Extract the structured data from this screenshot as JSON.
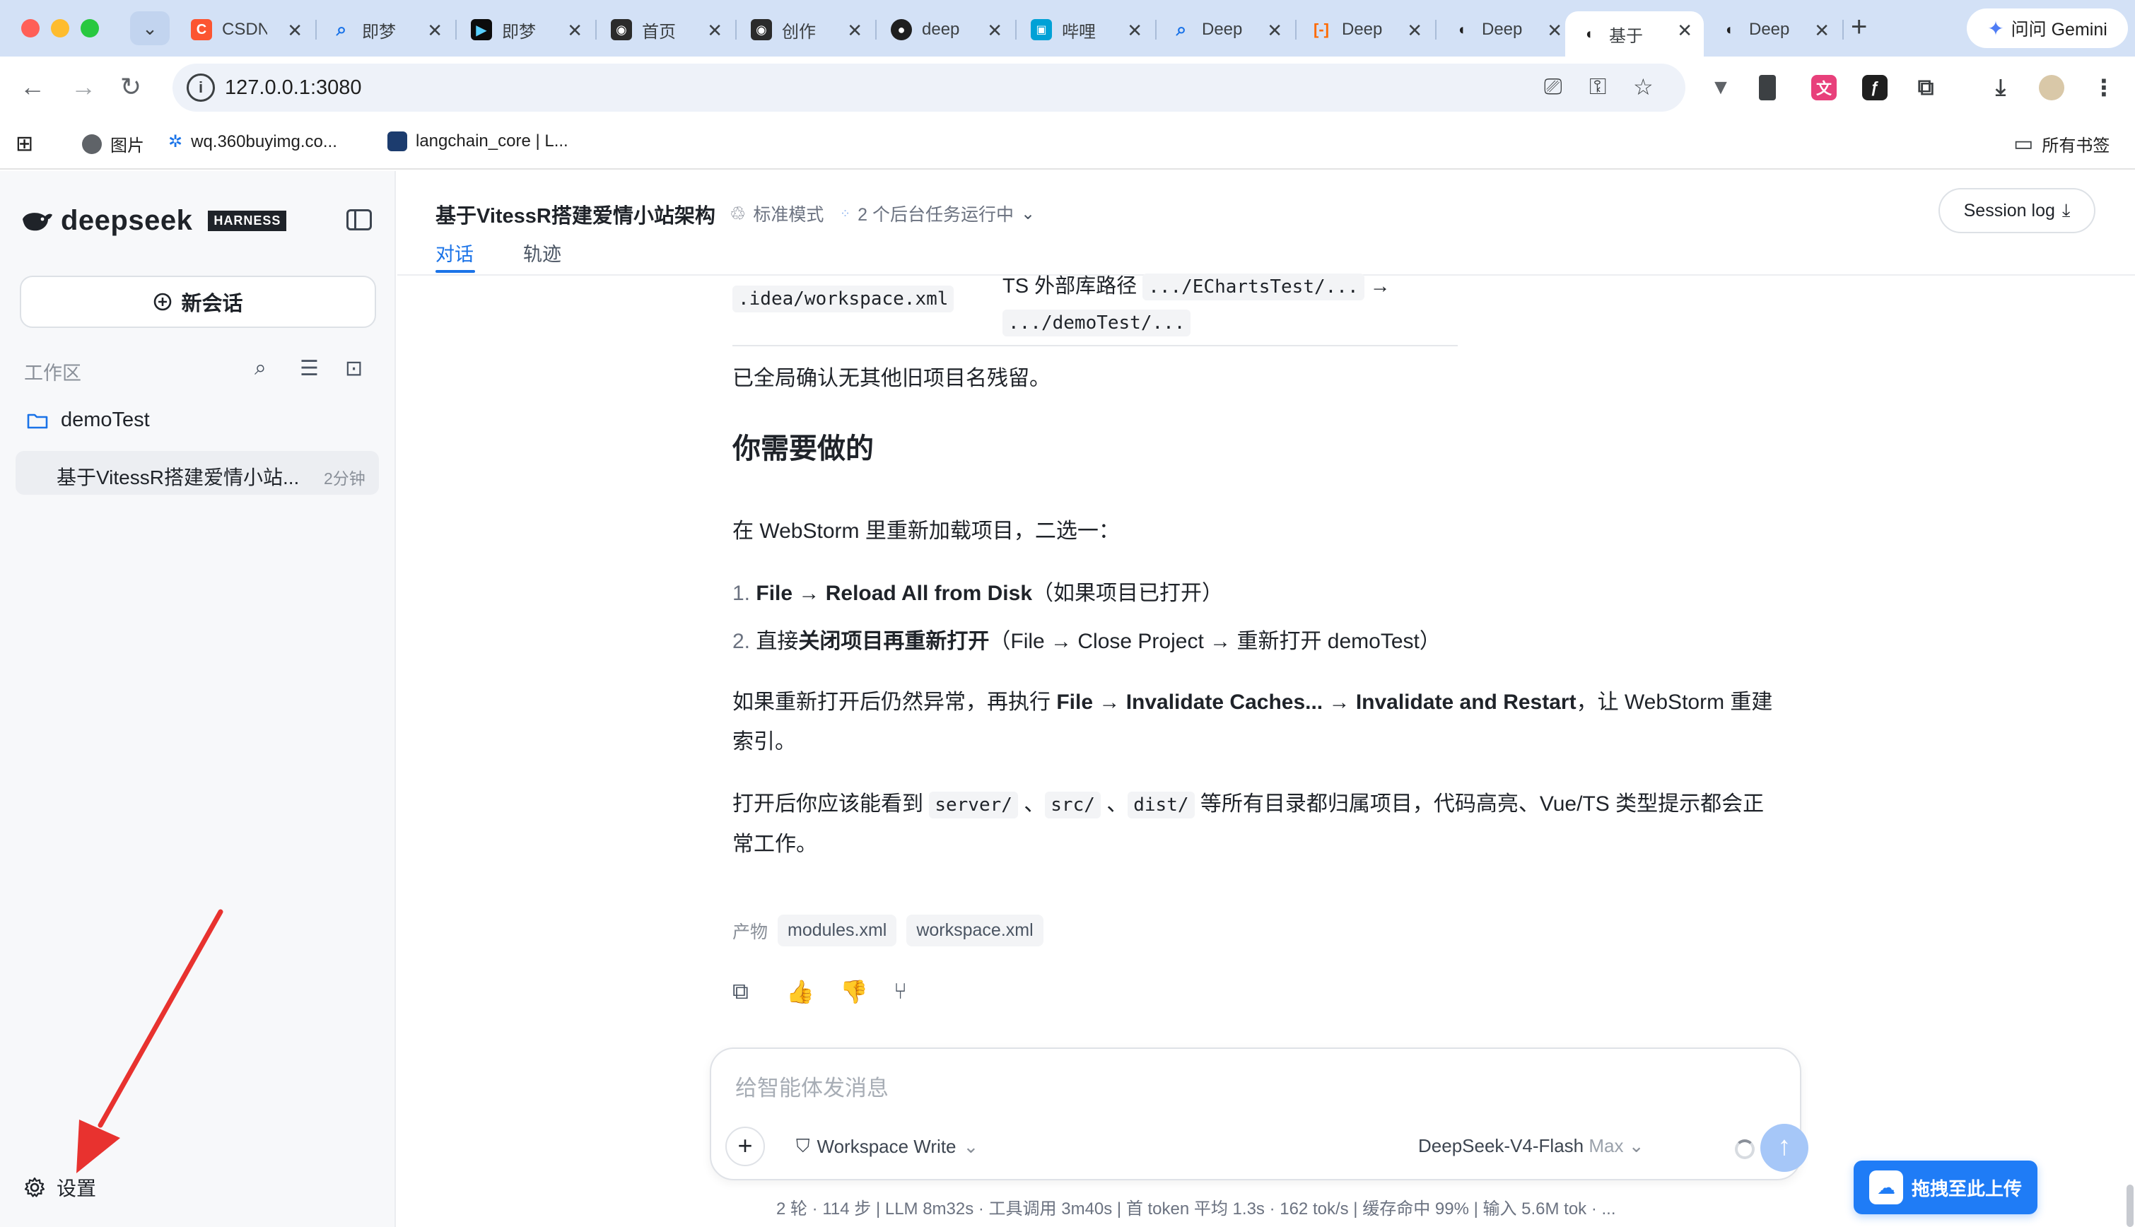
{
  "browser": {
    "tabs": [
      {
        "title": "CSDN",
        "icon": "csdn-icon",
        "color": "#fc5531"
      },
      {
        "title": "即梦",
        "icon": "search-icon",
        "color": "#1a73e8"
      },
      {
        "title": "即梦",
        "icon": "jimeng-icon",
        "color": "#0c0c0c"
      },
      {
        "title": "首页",
        "icon": "robot-icon",
        "color": "#2b2b2b"
      },
      {
        "title": "创作",
        "icon": "robot-icon",
        "color": "#2b2b2b"
      },
      {
        "title": "deep",
        "icon": "github-icon",
        "color": "#1f1f1f"
      },
      {
        "title": "哔哩",
        "icon": "bilibili-icon",
        "color": "#00a1d6"
      },
      {
        "title": "Deep",
        "icon": "search-icon",
        "color": "#1a73e8"
      },
      {
        "title": "Deep",
        "icon": "bracket-icon",
        "color": "#ff6a00"
      },
      {
        "title": "Deep",
        "icon": "whale-icon",
        "color": "#1f1f1f"
      },
      {
        "title": "基于",
        "icon": "whale-icon",
        "color": "#1f1f1f",
        "active": true
      },
      {
        "title": "Deep",
        "icon": "whale-icon",
        "color": "#1f1f1f"
      }
    ],
    "gemini_label": "问问 Gemini",
    "url": "127.0.0.1:3080",
    "bookmarks": [
      {
        "label": "图片"
      },
      {
        "label": "wq.360buyimg.co..."
      },
      {
        "label": "langchain_core | L..."
      }
    ],
    "all_bookmarks": "所有书签"
  },
  "sidebar": {
    "brand": "deepseek",
    "badge": "HARNESS",
    "new_chat": "新会话",
    "workspace_label": "工作区",
    "project": "demoTest",
    "session_title": "基于VitessR搭建爱情小站...",
    "session_time": "2分钟",
    "settings": "设置"
  },
  "header": {
    "title": "基于VitessR搭建爱情小站架构",
    "mode": "标准模式",
    "tasks": "2 个后台任务运行中",
    "tab_chat": "对话",
    "tab_trace": "轨迹",
    "session_log": "Session log"
  },
  "content": {
    "prev_file": ".idea/workspace.xml",
    "prev_desc": "TS 外部库路径",
    "prev_from": ".../EChartsTest/...",
    "prev_to": ".../demoTest/...",
    "confirm": "已全局确认无其他旧项目名残留。",
    "heading": "你需要做的",
    "intro": "在 WebStorm 里重新加载项目，二选一：",
    "item1_num": "1.",
    "item1_bold": "File → Reload All from Disk",
    "item1_rest": "（如果项目已打开）",
    "item2_num": "2.",
    "item2_pre": "直接",
    "item2_bold": "关闭项目再重新打开",
    "item2_rest": "（File → Close Project → 重新打开 demoTest）",
    "para1_pre": "如果重新打开后仍然异常，再执行 ",
    "para1_bold": "File → Invalidate Caches... → Invalidate and Restart",
    "para1_rest": "，让 WebStorm 重建索引。",
    "para2_pre": "打开后你应该能看到 ",
    "code1": "server/",
    "code2": "src/",
    "code3": "dist/",
    "para2_rest": " 等所有目录都归属项目，代码高亮、Vue/TS 类型提示都会正常工作。",
    "artifacts_label": "产物",
    "artifact1": "modules.xml",
    "artifact2": "workspace.xml"
  },
  "composer": {
    "placeholder": "给智能体发消息",
    "permission": "Workspace Write",
    "model": "DeepSeek-V4-Flash",
    "model_tier": "Max"
  },
  "stats": "2 轮 · 114 步   |   LLM 8m32s · 工具调用 3m40s   |   首 token 平均 1.3s · 162 tok/s   |   缓存命中 99%   |   输入 5.6M tok · ...",
  "upload_label": "拖拽至此上传",
  "colors": {
    "accent": "#1a73e8",
    "upload": "#1f7cf6",
    "annotation_arrow": "#e8322f"
  }
}
